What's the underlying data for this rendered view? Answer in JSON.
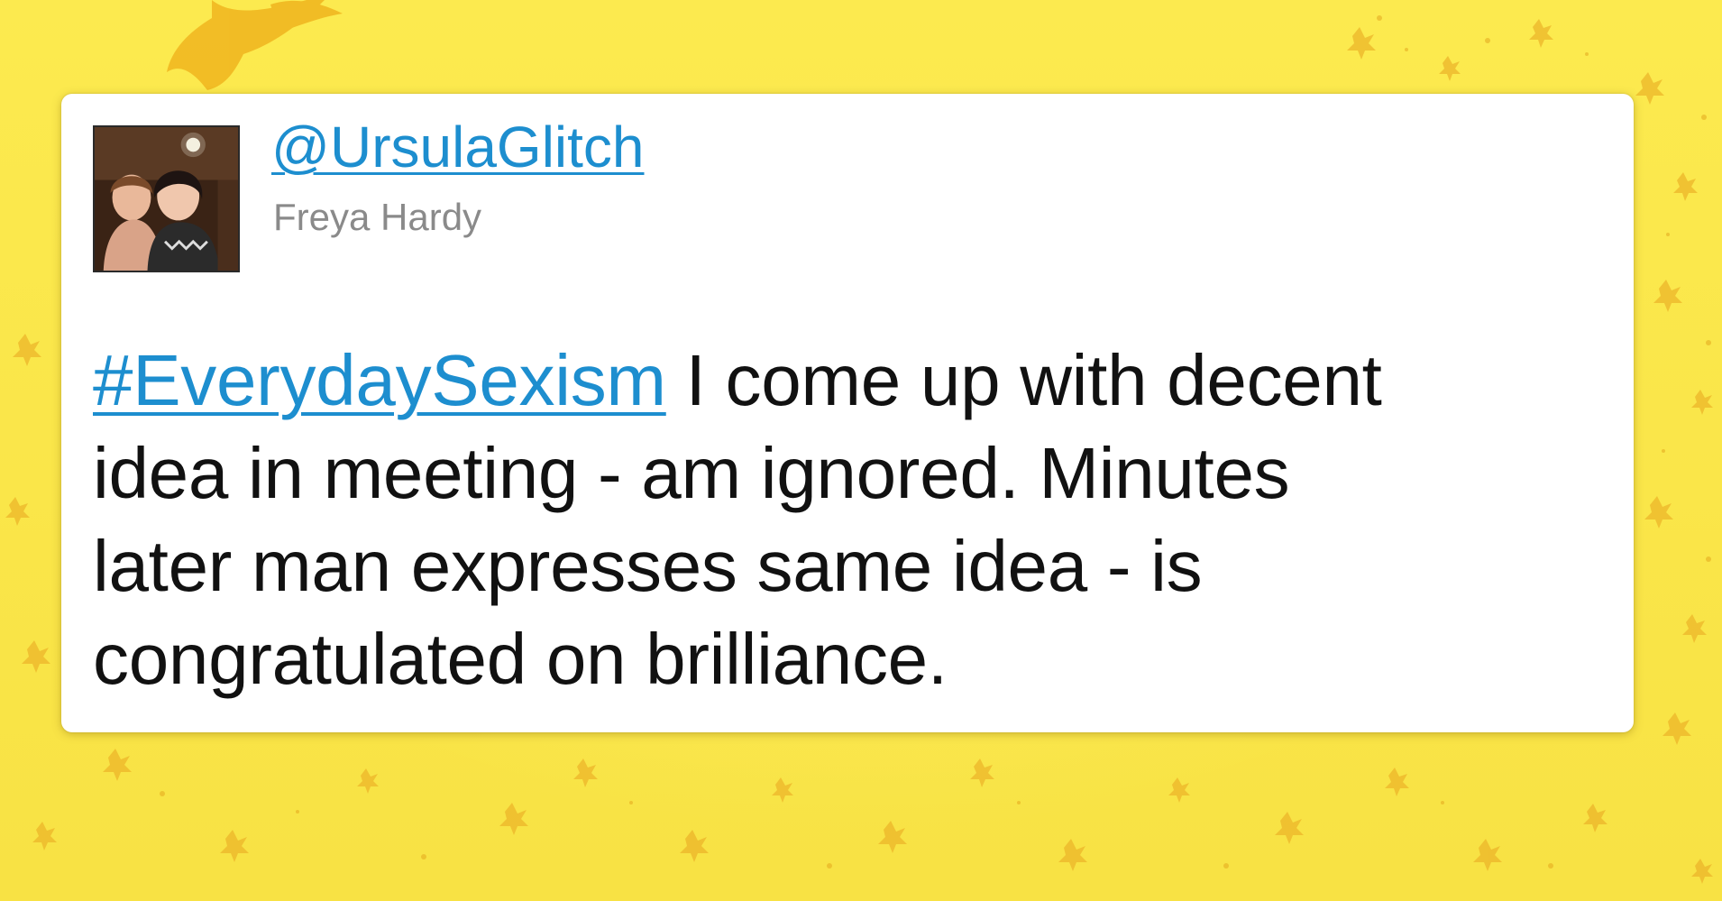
{
  "tweet": {
    "handle": "@UrsulaGlitch",
    "display_name": "Freya Hardy",
    "hashtag": "#EverydaySexism",
    "line1_rest": " I come up with decent",
    "line2": "idea in meeting - am ignored. Minutes",
    "line3": "later man expresses same idea - is",
    "line4": "congratulated on brilliance."
  },
  "colors": {
    "background": "#fbe74a",
    "link": "#1d8ecf",
    "name": "#8a8a8a",
    "text": "#111111",
    "card": "#ffffff",
    "leaf": "#e8b820"
  },
  "icons": {
    "avatar": "profile-photo"
  }
}
